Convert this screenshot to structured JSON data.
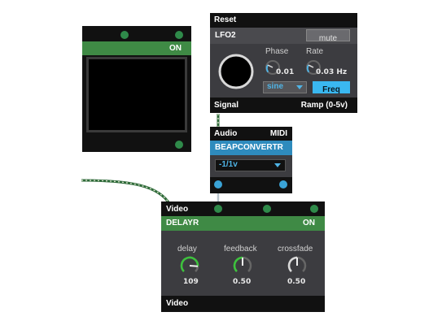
{
  "colors": {
    "green_bar": "#3f8a45",
    "blue_bar": "#2e8bbd",
    "port_green": "#2f8a4a",
    "port_blue": "#3aa3d6",
    "knob_green": "#3cc23c",
    "knob_blue": "#4fb4e6",
    "accent_blue": "#3ab8f0"
  },
  "scope": {
    "toggle_label": "ON"
  },
  "lfo": {
    "reset_label": "Reset",
    "title": "LFO2",
    "mute_label": "mute",
    "phase": {
      "label": "Phase",
      "value": "0.01"
    },
    "rate": {
      "label": "Rate",
      "value": "0.03 Hz"
    },
    "waveform": {
      "value": "sine"
    },
    "freq_label": "Freq",
    "signal_label": "Signal",
    "ramp_label": "Ramp (0-5v)"
  },
  "converter": {
    "audio_label": "Audio",
    "midi_label": "MIDI",
    "title": "BEAPCONVERTR",
    "mode": {
      "value": "-1/1v"
    }
  },
  "delay": {
    "video_in_label": "Video",
    "title": "DELAYR",
    "on_label": "ON",
    "knobs": [
      {
        "label": "delay",
        "value": "109",
        "level": 0.85
      },
      {
        "label": "feedback",
        "value": "0.50",
        "level": 0.5
      },
      {
        "label": "crossfade",
        "value": "0.50",
        "level": 0.5
      }
    ],
    "video_out_label": "Video"
  }
}
